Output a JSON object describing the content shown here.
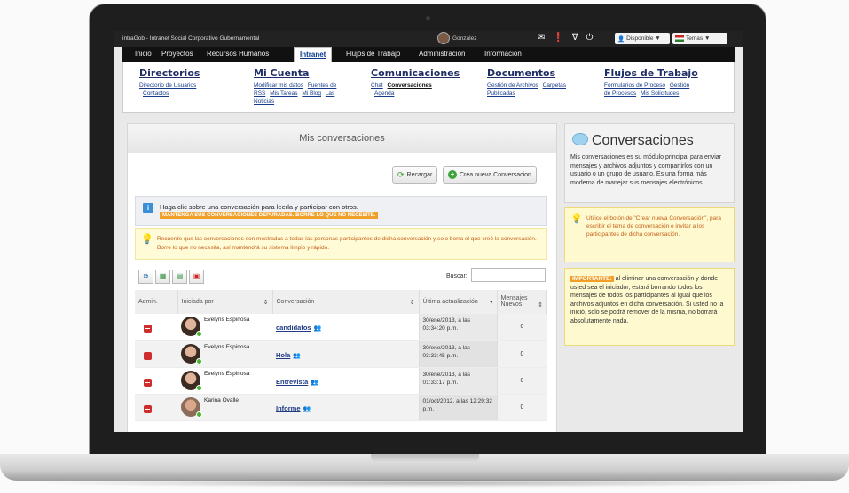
{
  "topbar": {
    "title": "intraGob - Intranet Social Corporativo Gubernamental",
    "user_name": "González",
    "status_label": "Disponible ▼",
    "theme_label": "Temas ▼",
    "icons": [
      "mail-icon",
      "alert-icon",
      "filter-icon",
      "power-icon"
    ]
  },
  "nav": {
    "tabs": [
      {
        "label": "Inicio",
        "active": false
      },
      {
        "label": "Proyectos",
        "active": false
      },
      {
        "label": "Recursos Humanos",
        "active": false
      },
      {
        "label": "Intranet",
        "active": true
      },
      {
        "label": "Flujos de Trabajo",
        "active": false
      },
      {
        "label": "Administración",
        "active": false
      },
      {
        "label": "Información",
        "active": false
      }
    ]
  },
  "megamenu": {
    "directorios": {
      "title": "Directorios",
      "links": [
        "Directorio de Usuarios",
        "Contactos"
      ]
    },
    "micuenta": {
      "title": "Mi Cuenta",
      "links": [
        "Modificar mis datos",
        "Fuentes de",
        "RSS",
        "Mis Tareas",
        "Mi Blog",
        "Las",
        "Noticias"
      ]
    },
    "comunicaciones": {
      "title": "Comunicaciones",
      "links": [
        "Chat",
        "Conversaciones",
        "Agenda"
      ]
    },
    "documentos": {
      "title": "Documentos",
      "links": [
        "Gestión de Archivos",
        "Carpetas",
        "Publicadas"
      ]
    },
    "flujos": {
      "title": "Flujos de Trabajo",
      "links": [
        "Formularios de Proceso",
        "Gestión",
        "de Procesos",
        "Mis Solicitudes"
      ]
    }
  },
  "main": {
    "title": "Mis conversaciones",
    "reload_label": "Recargar",
    "new_label": "Crea nueva Conversacion",
    "info_text": "Haga clic sobre una conversación para leerla y participar con otros.",
    "info_tag": "MANTENGA SUS CONVERSACIONES DEPURADAS. BORRE LO QUE NO NECESITE.",
    "warning_text": "Recuerde que las conversaciones son mostradas a todas las personas participantes de dicha conversación y solo borra el que creó la conversación. Borre lo que no necesita, así mantendrá su sistema limpio y rápido.",
    "search_label": "Buscar:",
    "search_value": "",
    "columns": {
      "admin": "Admin.",
      "started_by": "Iniciada por",
      "conversation": "Conversación",
      "last_update": "Última actualización",
      "new_messages": "Mensajes Nuevos"
    },
    "rows": [
      {
        "person": "Evelyns Espinosa",
        "conversation": "candidatos",
        "date": "30/ene/2013, a las 03:34:20 p.m.",
        "count": "0"
      },
      {
        "person": "Evelyns Espinosa",
        "conversation": "Hola",
        "date": "30/ene/2013, a las 03:33:45 p.m.",
        "count": "0"
      },
      {
        "person": "Evelyns Espinosa",
        "conversation": "Entrevista",
        "date": "30/ene/2013, a las 01:33:17 p.m.",
        "count": "0"
      },
      {
        "person": "Karina Ovalle",
        "conversation": "Informe",
        "date": "01/oct/2012, a las 12:29:32 p.m.",
        "count": "0"
      }
    ]
  },
  "sidebar": {
    "title": "Conversaciones",
    "description": "Mis conversaciones es su módulo principal para enviar mensajes y archivos adjuntos y compartirlos con un usuario o un grupo de usuario. Es una forma más moderna de manejar sus mensajes electrónicos.",
    "tip": "Utilice el botón de \"Crear nueva Conversación\", para escribir el tema de conversación e invitar a los participantes de dicha conversación.",
    "important_tag": "IMPORTANTE:",
    "important_text": "al eliminar una conversación y donde usted sea el iniciador, estará borrando todos los mensajes de todos los participantes al igual que los archivos adjuntos en dicha conversación. Si usted no la inició, solo se podrá remover de la misma, no borrará absolutamente nada."
  }
}
